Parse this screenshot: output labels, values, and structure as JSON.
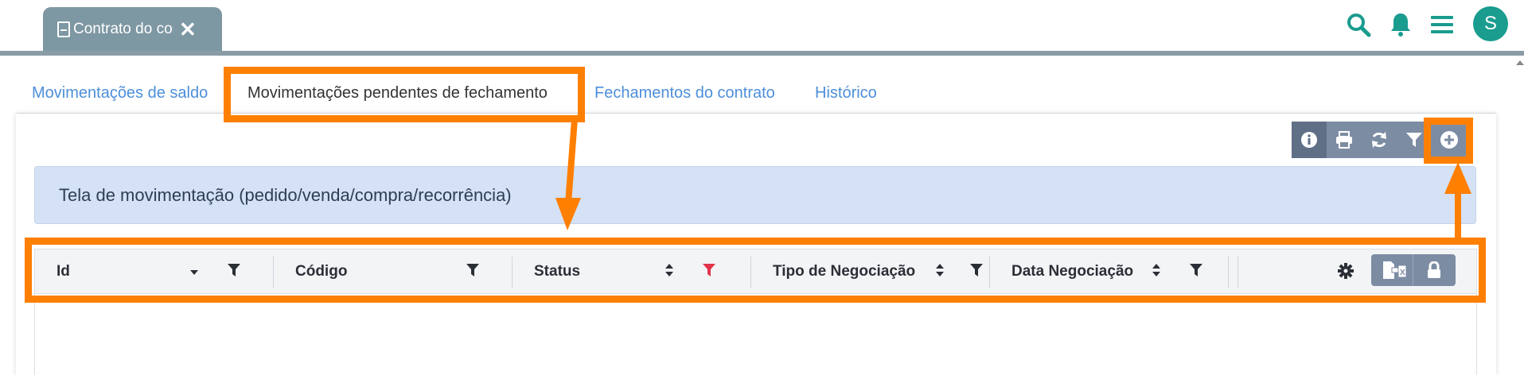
{
  "app": {
    "document_tab": {
      "label": "Contrato do contrato",
      "close_glyph": "✕"
    },
    "avatar_letter": "S",
    "accent_color": "#1a9c8f"
  },
  "subtabs": [
    {
      "label": "Movimentações de saldo",
      "active": false
    },
    {
      "label": "Movimentações pendentes de fechamento",
      "active": true
    },
    {
      "label": "Fechamentos do contrato",
      "active": false
    },
    {
      "label": "Histórico",
      "active": false
    }
  ],
  "actions": [
    "info-icon",
    "print-icon",
    "refresh-icon",
    "filter-icon",
    "add-icon"
  ],
  "alert": {
    "text": "Tela de movimentação (pedido/venda/compra/recorrência)"
  },
  "grid": {
    "columns": [
      {
        "label": "Id",
        "sort": "descending",
        "filter_active": false
      },
      {
        "label": "Código",
        "sort": "none",
        "filter_active": false
      },
      {
        "label": "Status",
        "sort": "both",
        "filter_active": true
      },
      {
        "label": "Tipo de Negociação",
        "sort": "both",
        "filter_active": false
      },
      {
        "label": "Data Negociação",
        "sort": "both",
        "filter_active": false
      }
    ],
    "tools": [
      "gear-icon",
      "export-excel-icon",
      "lock-icon"
    ]
  },
  "colors": {
    "highlight": "#ff7f00",
    "link": "#4d8fd9",
    "tab_bg": "#7d97a3",
    "alert_bg": "#d5e1f4",
    "filter_active": "#e0344b"
  }
}
